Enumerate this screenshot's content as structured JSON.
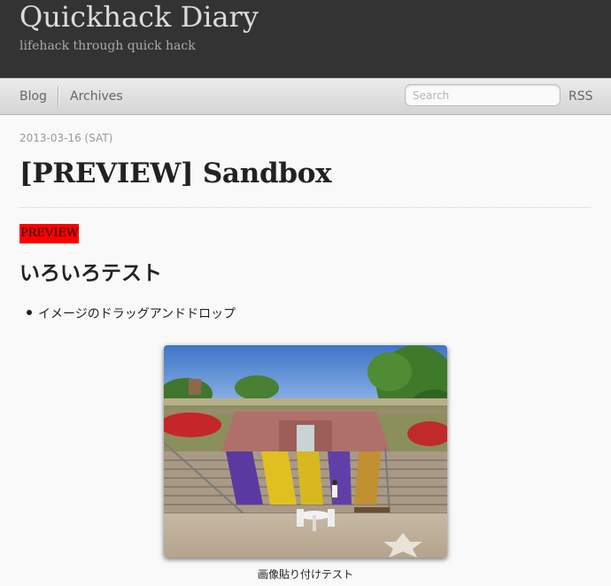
{
  "header": {
    "site_title": "Quickhack Diary",
    "tagline": "lifehack through quick hack"
  },
  "nav": {
    "blog": "Blog",
    "archives": "Archives",
    "search_placeholder": "Search",
    "rss": "RSS"
  },
  "post": {
    "date": "2013-03-16 (SAT)",
    "title": "[PREVIEW] Sandbox",
    "badge": "PREVIEW",
    "heading": "いろいろテスト",
    "bullets": [
      "イメージのドラッグアンドドロップ"
    ],
    "image_caption": "画像貼り付けテスト"
  },
  "colors": {
    "header_bg": "#333333",
    "badge_bg": "#ff0000"
  }
}
